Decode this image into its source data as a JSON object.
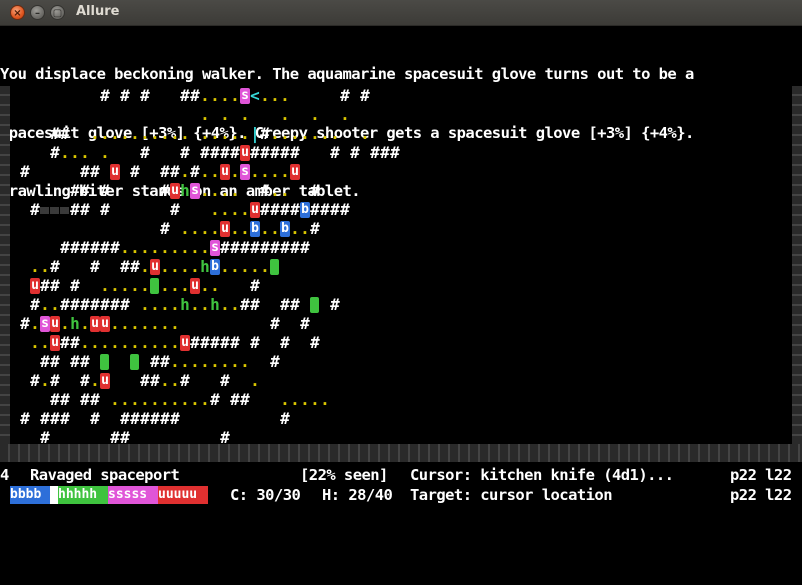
{
  "window": {
    "title": "Allure",
    "close_glyph": "×",
    "min_glyph": "–",
    "max_glyph": "▢"
  },
  "messages": [
    "You displace beckoning walker. The aquamarine spacesuit glove turns out to be a",
    "spacesuit glove [+3%] {+4%}. Creepy shooter gets a spacesuit glove [+3%] {+4%}.",
    "Crawling biter stands on an amber tablet."
  ],
  "status": {
    "level": "4",
    "location": "Ravaged spaceport",
    "seen": "[22% seen]",
    "cursor": "Cursor: kitchen knife (4d1)...",
    "pos1": "p22 l22",
    "calm": "C: 30/30",
    "hp": "H: 28/40",
    "target": "Target: cursor location",
    "pos2": "p22 l22"
  },
  "party_bars": [
    {
      "label": "bbbb",
      "color": "#2d6fd9"
    },
    {
      "label": "",
      "color": "#ffffff"
    },
    {
      "label": "hhhhh",
      "color": "#3fc33f"
    },
    {
      "label": "sssss",
      "color": "#e055d8"
    },
    {
      "label": "uuuuu",
      "color": "#e03030"
    }
  ],
  "colors": {
    "wall": "#ffffff",
    "floor_lit": "#d8c400",
    "floor_green": "#3fc33f",
    "actor_blue": "#2d6fd9",
    "actor_green": "#3fc33f",
    "actor_pink": "#e055d8",
    "actor_red": "#e03030",
    "item_cyan": "#35d8d8",
    "item_brown": "#b25a00",
    "rock": "#3a3a3a"
  },
  "map_rows": [
    "         # # #   ##....sC...     # #            ",
    "                   . . .   .  .  .              ",
    "    ##  .......... .....|#.......  .            ",
    "    #... .   #   # ####u#####   # # ###         ",
    " #     ## u #  ##.#..u.s....u                   ",
    "      ## #     #uhs....  #..  #                 ",
    "  #:::## #      #   ....u####b####               ",
    "               # ....u..b..b..#                 ",
    "     ######.........s#########                  ",
    "  ..#   #  ##.u....hb.....O                      ",
    "  u## #  .....O...u..   #                       ",
    "  #..####### ....h..h..##  ## O #               ",
    " #.su.h.uu.......         #  #                  ",
    "  ..u##..........u##### #  #  #                 ",
    "   ## ## O  O ##........  #                     ",
    "  #.#  #.u   ##..#   #  .                       ",
    "    ## ## ..........# ##   .....                ",
    " # ###  #  ######          #                   ",
    "   #      ##         #                          "
  ]
}
